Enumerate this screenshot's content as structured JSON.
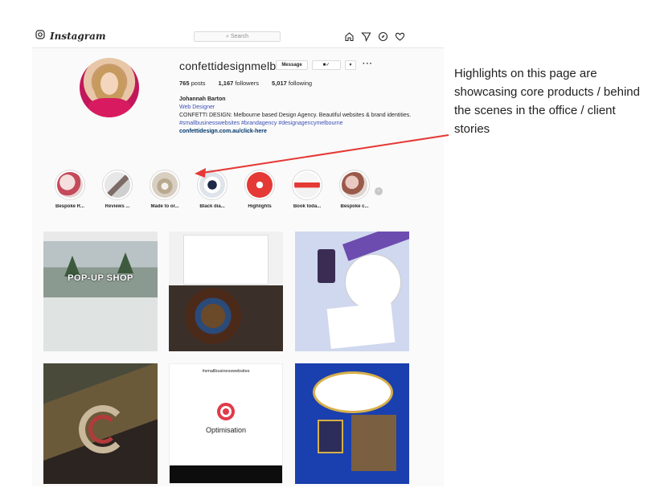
{
  "topbar": {
    "brand": "Instagram",
    "search_placeholder": "Search"
  },
  "profile": {
    "username": "confettidesignmelb",
    "message_label": "Message",
    "stats": {
      "posts": "765",
      "posts_label": "posts",
      "followers": "1,167",
      "followers_label": "followers",
      "following": "5,017",
      "following_label": "following"
    },
    "bio": {
      "name": "Johannah Barton",
      "category": "Web Designer",
      "text": "CONFETTI DESIGN: Melbourne based Design Agency. Beautiful websites & brand identities.",
      "hashtags": "#smallbusinesswebsites #brandagency #designagencymelbourne",
      "link": "confettidesign.com.au/click-here"
    }
  },
  "highlights": [
    {
      "label": "Bespoke R..."
    },
    {
      "label": "Reviews ..."
    },
    {
      "label": "Made to or..."
    },
    {
      "label": "Black dia..."
    },
    {
      "label": "Highlights"
    },
    {
      "label": "Book toda..."
    },
    {
      "label": "Bespoke c..."
    }
  ],
  "posts": {
    "p1_text": "POP-UP SHOP",
    "p5_top": "#smallbusinesswebsites",
    "p5_word": "Optimisation"
  },
  "annotation": {
    "text": "Highlights on this page are showcasing core products / behind the scenes in the office / client stories"
  },
  "colors": {
    "annotation_arrow": "#e53935",
    "link_blue": "#00376b"
  }
}
